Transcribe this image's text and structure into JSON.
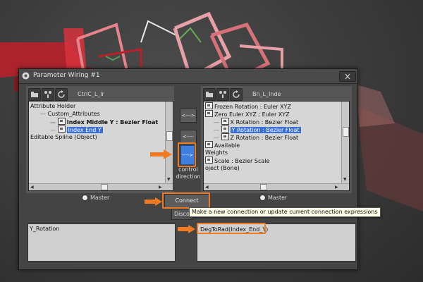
{
  "dialog": {
    "title": "Parameter Wiring #1"
  },
  "left_panel": {
    "node_name": "CtrlC_L_lr",
    "tree": [
      {
        "label": "Attribute Holder",
        "level": 0,
        "bold": false,
        "selected": false,
        "icon": false
      },
      {
        "label": "Custom_Attributes",
        "level": 1,
        "bold": false,
        "selected": false,
        "icon": false
      },
      {
        "label": "Index Middle Y : Bezier Float",
        "level": 2,
        "bold": true,
        "selected": false,
        "icon": true
      },
      {
        "label": "Index End Y",
        "level": 2,
        "bold": false,
        "selected": true,
        "icon": true
      },
      {
        "label": "Editable Spline (Object)",
        "level": 0,
        "bold": false,
        "selected": false,
        "icon": false
      }
    ],
    "master_label": "Master",
    "expression": "Y_Rotation"
  },
  "right_panel": {
    "node_name": "Bn_L_Inde",
    "tree": [
      {
        "label": "Frozen Rotation : Euler XYZ",
        "level": 0,
        "bold": false,
        "selected": false,
        "icon": true
      },
      {
        "label": "Zero Euler XYZ : Euler XYZ",
        "level": 0,
        "bold": false,
        "selected": false,
        "icon": true
      },
      {
        "label": "X Rotation : Bezier Float",
        "level": 1,
        "bold": false,
        "selected": false,
        "icon": true
      },
      {
        "label": "Y Rotation : Bezier Float",
        "level": 1,
        "bold": false,
        "selected": true,
        "icon": true
      },
      {
        "label": "Z Rotation : Bezier Float",
        "level": 1,
        "bold": false,
        "selected": false,
        "icon": true
      },
      {
        "label": "Available",
        "level": 0,
        "bold": false,
        "selected": false,
        "icon": true
      },
      {
        "label": "Weights",
        "level": 0,
        "bold": false,
        "selected": false,
        "icon": false
      },
      {
        "label": "Scale : Bezier Scale",
        "level": 0,
        "bold": false,
        "selected": false,
        "icon": true
      },
      {
        "label": "oject (Bone)",
        "level": 0,
        "bold": false,
        "selected": false,
        "icon": false
      }
    ],
    "master_label": "Master",
    "expression": "DegToRad(Index_End_Y)"
  },
  "middle": {
    "both_ways_label": "<--->",
    "left_arrow_label": "<----",
    "direction_label": "---->",
    "control_direction_label": "control\ndirection"
  },
  "connect_label": "Connect",
  "disconnect_label": "Disconnect",
  "tooltip": "Make a new connection or update current connection expressions",
  "colors": {
    "highlight": "#f07a22",
    "selection": "#3b6fd8",
    "direction_button": "#3e7fe0"
  }
}
